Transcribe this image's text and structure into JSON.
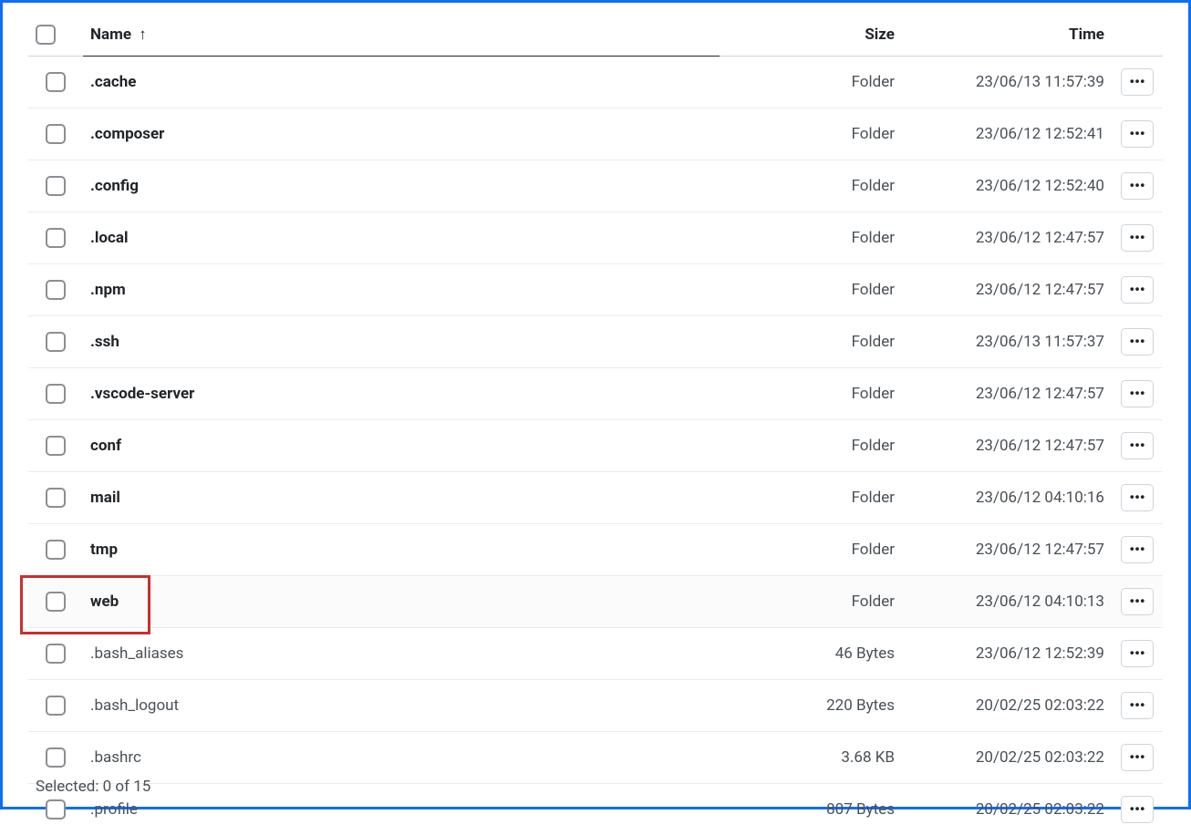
{
  "columns": {
    "name": "Name",
    "size": "Size",
    "time": "Time"
  },
  "sort": {
    "column": "name",
    "direction": "asc",
    "arrow": "↑"
  },
  "rows": [
    {
      "name": ".cache",
      "size": "Folder",
      "time": "23/06/13 11:57:39",
      "isFolder": true
    },
    {
      "name": ".composer",
      "size": "Folder",
      "time": "23/06/12 12:52:41",
      "isFolder": true
    },
    {
      "name": ".config",
      "size": "Folder",
      "time": "23/06/12 12:52:40",
      "isFolder": true
    },
    {
      "name": ".local",
      "size": "Folder",
      "time": "23/06/12 12:47:57",
      "isFolder": true
    },
    {
      "name": ".npm",
      "size": "Folder",
      "time": "23/06/12 12:47:57",
      "isFolder": true
    },
    {
      "name": ".ssh",
      "size": "Folder",
      "time": "23/06/13 11:57:37",
      "isFolder": true
    },
    {
      "name": ".vscode-server",
      "size": "Folder",
      "time": "23/06/12 12:47:57",
      "isFolder": true
    },
    {
      "name": "conf",
      "size": "Folder",
      "time": "23/06/12 12:47:57",
      "isFolder": true
    },
    {
      "name": "mail",
      "size": "Folder",
      "time": "23/06/12 04:10:16",
      "isFolder": true
    },
    {
      "name": "tmp",
      "size": "Folder",
      "time": "23/06/12 12:47:57",
      "isFolder": true
    },
    {
      "name": "web",
      "size": "Folder",
      "time": "23/06/12 04:10:13",
      "isFolder": true,
      "highlighted": true
    },
    {
      "name": ".bash_aliases",
      "size": "46 Bytes",
      "time": "23/06/12 12:52:39",
      "isFolder": false
    },
    {
      "name": ".bash_logout",
      "size": "220 Bytes",
      "time": "20/02/25 02:03:22",
      "isFolder": false
    },
    {
      "name": ".bashrc",
      "size": "3.68 KB",
      "time": "20/02/25 02:03:22",
      "isFolder": false
    },
    {
      "name": ".profile",
      "size": "807 Bytes",
      "time": "20/02/25 02:03:22",
      "isFolder": false
    }
  ],
  "footer": {
    "selected_label": "Selected: 0 of 15"
  },
  "actions_glyph": "•••"
}
